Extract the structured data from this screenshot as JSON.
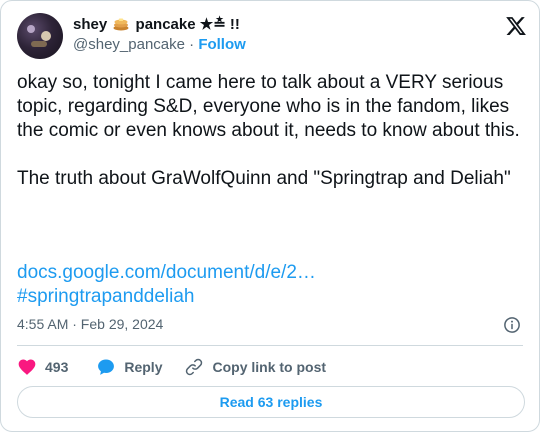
{
  "author": {
    "display_name_part1": "shey",
    "display_name_part2": "pancake ★≛ !!",
    "handle": "@shey_pancake",
    "separator": " · ",
    "follow_label": "Follow"
  },
  "tweet": {
    "text": "okay so, tonight I came here to talk about a VERY serious topic, regarding S&D, everyone who is in the fandom, likes the comic or even knows about it, needs to know about this.\n\nThe truth about GraWolfQuinn and \"Springtrap and Deliah\"",
    "link_url_text": "docs.google.com/document/d/e/2…",
    "hashtag": "#springtrapanddeliah",
    "timestamp": "4:55 AM · Feb 29, 2024"
  },
  "actions": {
    "likes_count": "493",
    "reply_label": "Reply",
    "copy_label": "Copy link to post",
    "read_replies_label": "Read 63 replies"
  },
  "colors": {
    "accent": "#1d9bf0",
    "like": "#f91880",
    "text": "#0f1419",
    "muted": "#536471",
    "border": "#cfd9de"
  },
  "icons": [
    "pancake-icon",
    "x-logo-icon",
    "info-icon",
    "heart-icon",
    "reply-bubble-icon",
    "link-icon"
  ]
}
